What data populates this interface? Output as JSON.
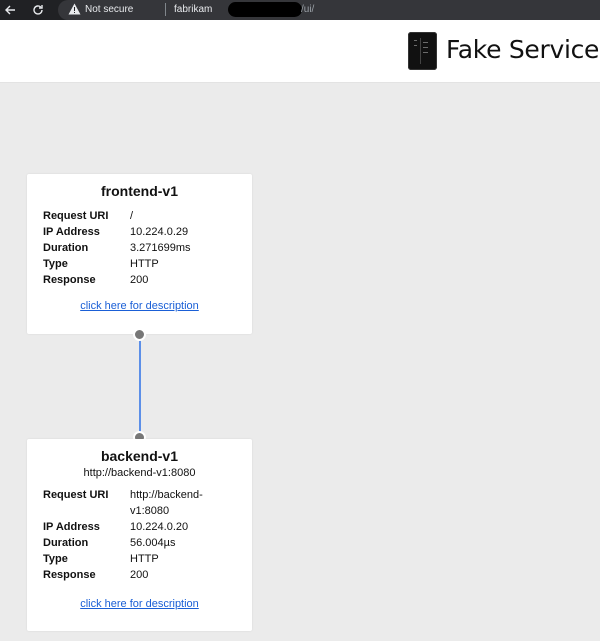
{
  "browser": {
    "security_label": "Not secure",
    "url_host": "fabrikam",
    "url_path": "/ui/"
  },
  "app": {
    "title": "Fake Service"
  },
  "services": [
    {
      "name": "frontend-v1",
      "subtitle": "",
      "details": [
        {
          "label": "Request URI",
          "value": "/"
        },
        {
          "label": "IP Address",
          "value": "10.224.0.29"
        },
        {
          "label": "Duration",
          "value": "3.271699ms"
        },
        {
          "label": "Type",
          "value": "HTTP"
        },
        {
          "label": "Response",
          "value": "200"
        }
      ],
      "link": "click here for description"
    },
    {
      "name": "backend-v1",
      "subtitle": "http://backend-v1:8080",
      "details": [
        {
          "label": "Request URI",
          "value": "http://backend-v1:8080"
        },
        {
          "label": "IP Address",
          "value": "10.224.0.20"
        },
        {
          "label": "Duration",
          "value": "56.004µs"
        },
        {
          "label": "Type",
          "value": "HTTP"
        },
        {
          "label": "Response",
          "value": "200"
        }
      ],
      "link": "click here for description"
    }
  ],
  "colors": {
    "connector": "#5c8fe8",
    "link": "#1a5fd6",
    "background": "#ebebeb"
  }
}
